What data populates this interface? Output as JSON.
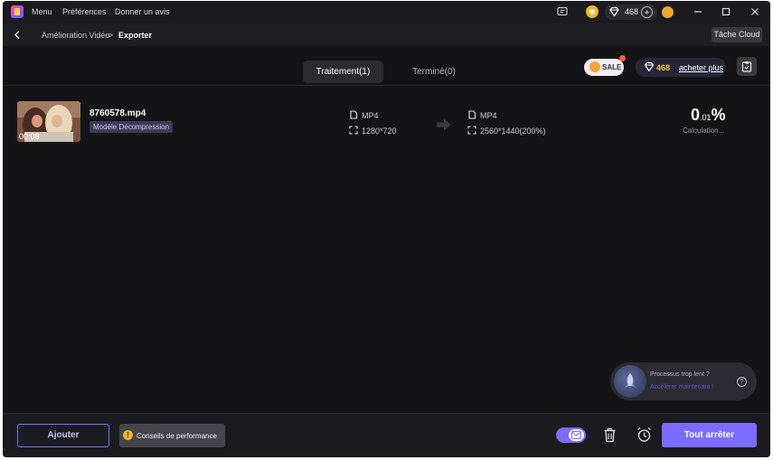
{
  "titlebar": {
    "menu": [
      "Menu",
      "Préférences",
      "Donner un avis"
    ],
    "credits": "468",
    "icons": [
      "app-logo-icon",
      "feedback-icon",
      "coin-icon",
      "diamond-icon",
      "plus-icon",
      "user-avatar-icon",
      "minimize-icon",
      "maximize-icon",
      "close-icon"
    ]
  },
  "breadcrumb": {
    "parent": "Amélioration Vidéo",
    "separator": ">",
    "current": "Exporter",
    "cloud_button": "Tâche Cloud"
  },
  "tabs": [
    {
      "label": "Traitement(1)",
      "active": true
    },
    {
      "label": "Terminé(0)",
      "active": false
    }
  ],
  "promo": {
    "sale_label": "SALE",
    "credits": "468",
    "buy_label": "acheter plus"
  },
  "job": {
    "file_name": "8760578.mp4",
    "duration": "00:08",
    "model_tag": "Modèle Décompression",
    "source_format": "MP4",
    "source_resolution": "1280*720",
    "target_format": "MP4",
    "target_resolution": "2560*1440(200%)",
    "progress_main": "0",
    "progress_fraction": ".01",
    "progress_unit": "%",
    "status": "Calculation..."
  },
  "speed_tip": {
    "line1": "Processus trop lent ?",
    "line2": "Accélérer maintenant !"
  },
  "bottom": {
    "add_label": "Ajouter",
    "perf_label": "Conseils de performance",
    "stop_label": "Tout arrêter"
  },
  "colors": {
    "accent": "#7b6cff",
    "background": "#141417",
    "credit_gold": "#ffc93d"
  }
}
